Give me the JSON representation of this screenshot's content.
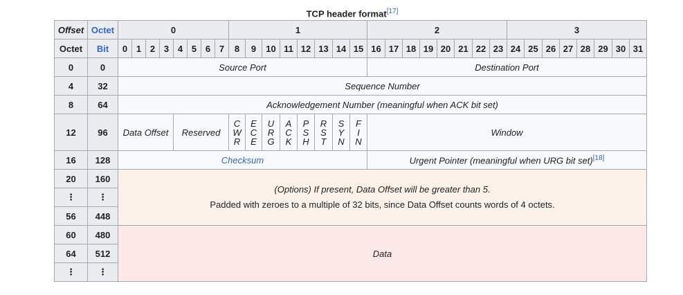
{
  "caption": "TCP header format",
  "caption_ref": "[17]",
  "header": {
    "offset_label": "Offset",
    "octet_label": "Octet",
    "octet_row_label": "Octet",
    "bit_label": "Bit",
    "octets": [
      "0",
      "1",
      "2",
      "3"
    ],
    "bits": [
      "0",
      "1",
      "2",
      "3",
      "4",
      "5",
      "6",
      "7",
      "8",
      "9",
      "10",
      "11",
      "12",
      "13",
      "14",
      "15",
      "16",
      "17",
      "18",
      "19",
      "20",
      "21",
      "22",
      "23",
      "24",
      "25",
      "26",
      "27",
      "28",
      "29",
      "30",
      "31"
    ]
  },
  "rows": {
    "r0": {
      "octet": "0",
      "bit": "0",
      "source_port": "Source Port",
      "destination_port": "Destination Port"
    },
    "r4": {
      "octet": "4",
      "bit": "32",
      "sequence_number": "Sequence Number"
    },
    "r8": {
      "octet": "8",
      "bit": "64",
      "ack_number": "Acknowledgement Number (meaningful when ACK bit set)"
    },
    "r12": {
      "octet": "12",
      "bit": "96",
      "data_offset": "Data Offset",
      "reserved": "Reserved",
      "window": "Window",
      "flags": [
        {
          "l1": "C",
          "l2": "W",
          "l3": "R"
        },
        {
          "l1": "E",
          "l2": "C",
          "l3": "E"
        },
        {
          "l1": "U",
          "l2": "R",
          "l3": "G"
        },
        {
          "l1": "A",
          "l2": "C",
          "l3": "K"
        },
        {
          "l1": "P",
          "l2": "S",
          "l3": "H"
        },
        {
          "l1": "R",
          "l2": "S",
          "l3": "T"
        },
        {
          "l1": "S",
          "l2": "Y",
          "l3": "N"
        },
        {
          "l1": "F",
          "l2": "I",
          "l3": "N"
        }
      ]
    },
    "r16": {
      "octet": "16",
      "bit": "128",
      "checksum": "Checksum",
      "urgent_pointer": "Urgent Pointer (meaningful when URG bit set)",
      "urgent_ref": "[18]"
    },
    "r20": {
      "octet": "20",
      "bit": "160"
    },
    "r_dots1": {
      "octet": "⋮",
      "bit": "⋮"
    },
    "r56": {
      "octet": "56",
      "bit": "448"
    },
    "options_line1": "(Options) If present, Data Offset will be greater than 5.",
    "options_line2": "Padded with zeroes to a multiple of 32 bits, since Data Offset counts words of 4 octets.",
    "r60": {
      "octet": "60",
      "bit": "480"
    },
    "r64": {
      "octet": "64",
      "bit": "512"
    },
    "r_dots2": {
      "octet": "⋮",
      "bit": "⋮"
    },
    "data_label": "Data"
  },
  "colors": {
    "header_bg": "#eaecf0",
    "cell_bg": "#f8f9fa",
    "options_bg": "#fdf2e9",
    "data_bg": "#fde8e8",
    "link": "#3366cc",
    "border": "#a2a9b1"
  }
}
